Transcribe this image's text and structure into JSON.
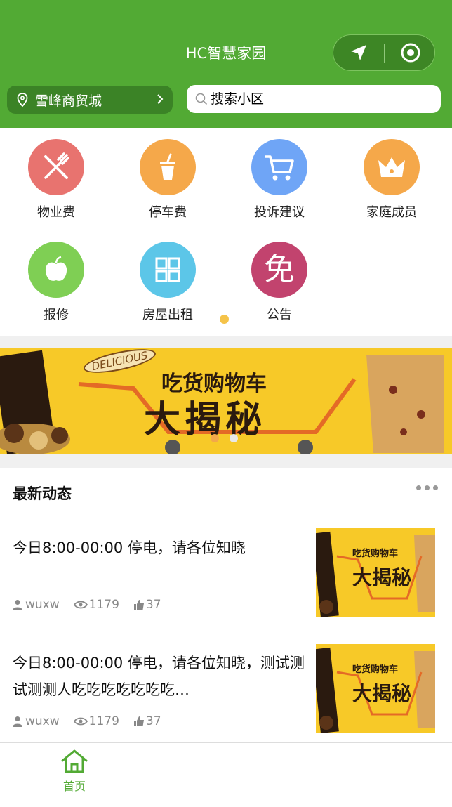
{
  "header": {
    "title": "HC智慧家园",
    "location": "雪峰商贸城",
    "search_placeholder": "搜索小区",
    "capsule": {
      "left_icon": "navigation-arrow-icon",
      "right_icon": "target-circle-icon"
    }
  },
  "menu": [
    {
      "label": "物业费",
      "icon": "fork-knife-icon",
      "color": "#e8736f"
    },
    {
      "label": "停车费",
      "icon": "cup-icon",
      "color": "#f5a84a"
    },
    {
      "label": "投诉建议",
      "icon": "cart-icon",
      "color": "#6fa5f6"
    },
    {
      "label": "家庭成员",
      "icon": "crown-icon",
      "color": "#f5a84a"
    },
    {
      "label": "报修",
      "icon": "apple-icon",
      "color": "#7fcf54"
    },
    {
      "label": "房屋出租",
      "icon": "grid-icon",
      "color": "#5cc6e8"
    },
    {
      "label": "公告",
      "icon": "免",
      "color": "#c2436e"
    }
  ],
  "banner": {
    "small_text": "DELICIOUS",
    "subtitle": "吃货购物车",
    "title": "大揭秘"
  },
  "news": {
    "heading": "最新动态",
    "items": [
      {
        "text": "今日8:00-00:00 停电，请各位知晓",
        "author": "wuxw",
        "views": "1179",
        "likes": "37"
      },
      {
        "text": "今日8:00-00:00 停电，请各位知晓，测试测试测测人吃吃吃吃吃吃吃…",
        "author": "wuxw",
        "views": "1179",
        "likes": "37"
      }
    ]
  },
  "tabbar": {
    "home_label": "首页"
  },
  "colors": {
    "brand_green": "#52aa34",
    "banner_yellow": "#f7c928"
  }
}
